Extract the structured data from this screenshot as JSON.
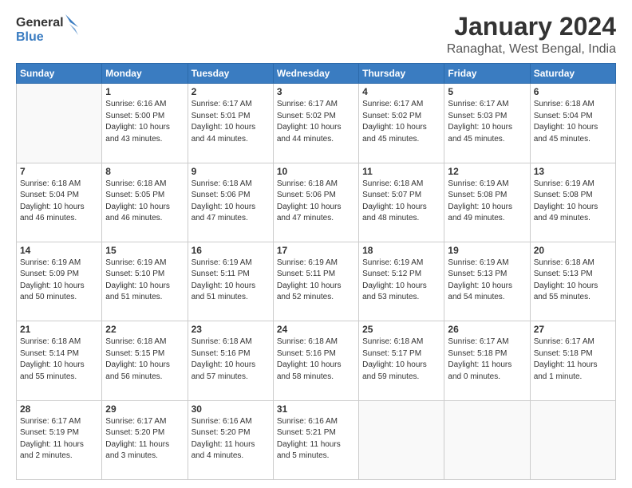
{
  "logo": {
    "line1": "General",
    "line2": "Blue"
  },
  "title": "January 2024",
  "subtitle": "Ranaghat, West Bengal, India",
  "days_of_week": [
    "Sunday",
    "Monday",
    "Tuesday",
    "Wednesday",
    "Thursday",
    "Friday",
    "Saturday"
  ],
  "weeks": [
    [
      {
        "num": "",
        "info": ""
      },
      {
        "num": "1",
        "info": "Sunrise: 6:16 AM\nSunset: 5:00 PM\nDaylight: 10 hours\nand 43 minutes."
      },
      {
        "num": "2",
        "info": "Sunrise: 6:17 AM\nSunset: 5:01 PM\nDaylight: 10 hours\nand 44 minutes."
      },
      {
        "num": "3",
        "info": "Sunrise: 6:17 AM\nSunset: 5:02 PM\nDaylight: 10 hours\nand 44 minutes."
      },
      {
        "num": "4",
        "info": "Sunrise: 6:17 AM\nSunset: 5:02 PM\nDaylight: 10 hours\nand 45 minutes."
      },
      {
        "num": "5",
        "info": "Sunrise: 6:17 AM\nSunset: 5:03 PM\nDaylight: 10 hours\nand 45 minutes."
      },
      {
        "num": "6",
        "info": "Sunrise: 6:18 AM\nSunset: 5:04 PM\nDaylight: 10 hours\nand 45 minutes."
      }
    ],
    [
      {
        "num": "7",
        "info": "Sunrise: 6:18 AM\nSunset: 5:04 PM\nDaylight: 10 hours\nand 46 minutes."
      },
      {
        "num": "8",
        "info": "Sunrise: 6:18 AM\nSunset: 5:05 PM\nDaylight: 10 hours\nand 46 minutes."
      },
      {
        "num": "9",
        "info": "Sunrise: 6:18 AM\nSunset: 5:06 PM\nDaylight: 10 hours\nand 47 minutes."
      },
      {
        "num": "10",
        "info": "Sunrise: 6:18 AM\nSunset: 5:06 PM\nDaylight: 10 hours\nand 47 minutes."
      },
      {
        "num": "11",
        "info": "Sunrise: 6:18 AM\nSunset: 5:07 PM\nDaylight: 10 hours\nand 48 minutes."
      },
      {
        "num": "12",
        "info": "Sunrise: 6:19 AM\nSunset: 5:08 PM\nDaylight: 10 hours\nand 49 minutes."
      },
      {
        "num": "13",
        "info": "Sunrise: 6:19 AM\nSunset: 5:08 PM\nDaylight: 10 hours\nand 49 minutes."
      }
    ],
    [
      {
        "num": "14",
        "info": "Sunrise: 6:19 AM\nSunset: 5:09 PM\nDaylight: 10 hours\nand 50 minutes."
      },
      {
        "num": "15",
        "info": "Sunrise: 6:19 AM\nSunset: 5:10 PM\nDaylight: 10 hours\nand 51 minutes."
      },
      {
        "num": "16",
        "info": "Sunrise: 6:19 AM\nSunset: 5:11 PM\nDaylight: 10 hours\nand 51 minutes."
      },
      {
        "num": "17",
        "info": "Sunrise: 6:19 AM\nSunset: 5:11 PM\nDaylight: 10 hours\nand 52 minutes."
      },
      {
        "num": "18",
        "info": "Sunrise: 6:19 AM\nSunset: 5:12 PM\nDaylight: 10 hours\nand 53 minutes."
      },
      {
        "num": "19",
        "info": "Sunrise: 6:19 AM\nSunset: 5:13 PM\nDaylight: 10 hours\nand 54 minutes."
      },
      {
        "num": "20",
        "info": "Sunrise: 6:18 AM\nSunset: 5:13 PM\nDaylight: 10 hours\nand 55 minutes."
      }
    ],
    [
      {
        "num": "21",
        "info": "Sunrise: 6:18 AM\nSunset: 5:14 PM\nDaylight: 10 hours\nand 55 minutes."
      },
      {
        "num": "22",
        "info": "Sunrise: 6:18 AM\nSunset: 5:15 PM\nDaylight: 10 hours\nand 56 minutes."
      },
      {
        "num": "23",
        "info": "Sunrise: 6:18 AM\nSunset: 5:16 PM\nDaylight: 10 hours\nand 57 minutes."
      },
      {
        "num": "24",
        "info": "Sunrise: 6:18 AM\nSunset: 5:16 PM\nDaylight: 10 hours\nand 58 minutes."
      },
      {
        "num": "25",
        "info": "Sunrise: 6:18 AM\nSunset: 5:17 PM\nDaylight: 10 hours\nand 59 minutes."
      },
      {
        "num": "26",
        "info": "Sunrise: 6:17 AM\nSunset: 5:18 PM\nDaylight: 11 hours\nand 0 minutes."
      },
      {
        "num": "27",
        "info": "Sunrise: 6:17 AM\nSunset: 5:18 PM\nDaylight: 11 hours\nand 1 minute."
      }
    ],
    [
      {
        "num": "28",
        "info": "Sunrise: 6:17 AM\nSunset: 5:19 PM\nDaylight: 11 hours\nand 2 minutes."
      },
      {
        "num": "29",
        "info": "Sunrise: 6:17 AM\nSunset: 5:20 PM\nDaylight: 11 hours\nand 3 minutes."
      },
      {
        "num": "30",
        "info": "Sunrise: 6:16 AM\nSunset: 5:20 PM\nDaylight: 11 hours\nand 4 minutes."
      },
      {
        "num": "31",
        "info": "Sunrise: 6:16 AM\nSunset: 5:21 PM\nDaylight: 11 hours\nand 5 minutes."
      },
      {
        "num": "",
        "info": ""
      },
      {
        "num": "",
        "info": ""
      },
      {
        "num": "",
        "info": ""
      }
    ]
  ]
}
